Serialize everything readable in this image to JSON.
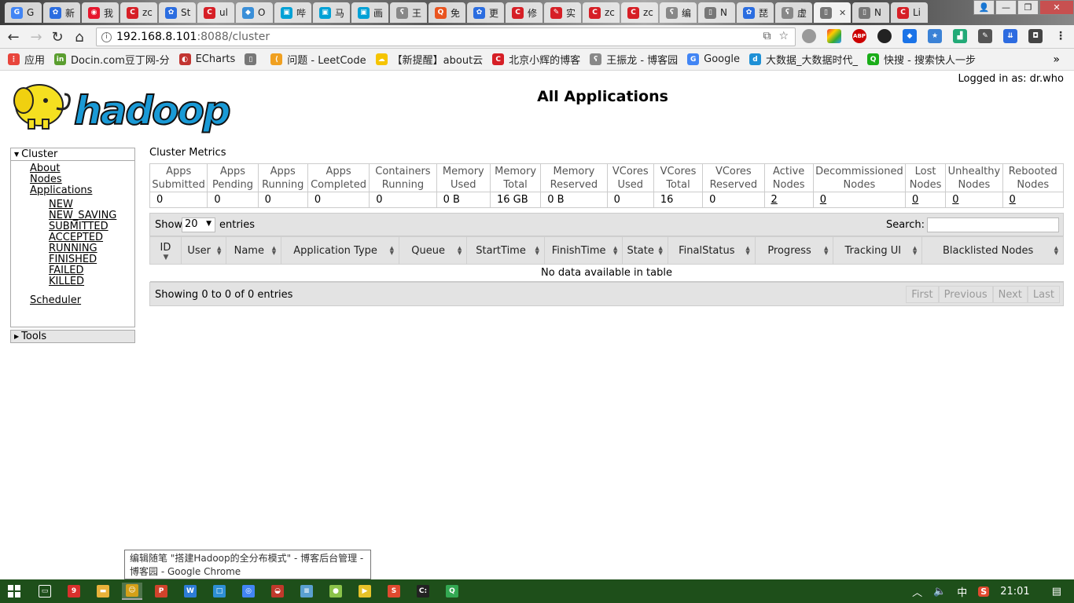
{
  "browser": {
    "tabs": [
      {
        "label": "G",
        "color": "#4285f4",
        "glyph": "G"
      },
      {
        "label": "新",
        "color": "#2b6de0",
        "glyph": "✿"
      },
      {
        "label": "我",
        "color": "#e6162d",
        "glyph": "◉"
      },
      {
        "label": "zc",
        "color": "#d61f26",
        "glyph": "C"
      },
      {
        "label": "St",
        "color": "#2b6de0",
        "glyph": "✿"
      },
      {
        "label": "ul",
        "color": "#d61f26",
        "glyph": "C"
      },
      {
        "label": "O",
        "color": "#3a8fd8",
        "glyph": "◆"
      },
      {
        "label": "哔",
        "color": "#00a1d6",
        "glyph": "▣"
      },
      {
        "label": "马",
        "color": "#00a1d6",
        "glyph": "▣"
      },
      {
        "label": "画",
        "color": "#00a1d6",
        "glyph": "▣"
      },
      {
        "label": "王",
        "color": "#888888",
        "glyph": "ʕ"
      },
      {
        "label": "免",
        "color": "#e9541f",
        "glyph": "Q"
      },
      {
        "label": "更",
        "color": "#2b6de0",
        "glyph": "✿"
      },
      {
        "label": "修",
        "color": "#d61f26",
        "glyph": "C"
      },
      {
        "label": "实",
        "color": "#d61f26",
        "glyph": "✎"
      },
      {
        "label": "zc",
        "color": "#d61f26",
        "glyph": "C"
      },
      {
        "label": "zc",
        "color": "#d61f26",
        "glyph": "C"
      },
      {
        "label": "编",
        "color": "#888888",
        "glyph": "ʕ"
      },
      {
        "label": "N",
        "color": "#777777",
        "glyph": "▯"
      },
      {
        "label": "琵",
        "color": "#2b6de0",
        "glyph": "✿"
      },
      {
        "label": "虚",
        "color": "#888888",
        "glyph": "ʕ"
      },
      {
        "label": "",
        "color": "#777777",
        "glyph": "▯",
        "active": true
      },
      {
        "label": "N",
        "color": "#777777",
        "glyph": "▯"
      },
      {
        "label": "Li",
        "color": "#d61f26",
        "glyph": "C"
      }
    ],
    "address": {
      "host": "192.168.8.101",
      "path": ":8088/cluster"
    },
    "bookmarks": [
      {
        "label": "应用",
        "color": "#e8453c",
        "glyph": "⋮"
      },
      {
        "label": "Docin.com豆丁网-分",
        "color": "#5a9e2f",
        "glyph": "in"
      },
      {
        "label": "ECharts",
        "color": "#c23531",
        "glyph": "◐"
      },
      {
        "label": "",
        "color": "#777777",
        "glyph": "▯"
      },
      {
        "label": "问题 - LeetCode",
        "color": "#f0a020",
        "glyph": "⟨"
      },
      {
        "label": "【新提醒】about云",
        "color": "#f5c400",
        "glyph": "☁"
      },
      {
        "label": "北京小辉的博客",
        "color": "#d61f26",
        "glyph": "C"
      },
      {
        "label": "王振龙 - 博客园",
        "color": "#888888",
        "glyph": "ʕ"
      },
      {
        "label": "Google",
        "color": "#4285f4",
        "glyph": "G"
      },
      {
        "label": "大数据_大数据时代_",
        "color": "#1e90d6",
        "glyph": "d"
      },
      {
        "label": "快搜 - 搜索快人一步",
        "color": "#1aad19",
        "glyph": "Q"
      }
    ]
  },
  "page": {
    "logged_in": "Logged in as: dr.who",
    "title": "All Applications",
    "logo_text": "hadoop",
    "sidebar": {
      "cluster_label": "Cluster",
      "links": [
        "About",
        "Nodes",
        "Applications"
      ],
      "states": [
        "NEW",
        "NEW_SAVING",
        "SUBMITTED",
        "ACCEPTED",
        "RUNNING",
        "FINISHED",
        "FAILED",
        "KILLED"
      ],
      "scheduler": "Scheduler",
      "tools_label": "Tools"
    },
    "metrics": {
      "title": "Cluster Metrics",
      "headers": [
        [
          "Apps",
          "Submitted"
        ],
        [
          "Apps",
          "Pending"
        ],
        [
          "Apps",
          "Running"
        ],
        [
          "Apps",
          "Completed"
        ],
        [
          "Containers",
          "Running"
        ],
        [
          "Memory",
          "Used"
        ],
        [
          "Memory",
          "Total"
        ],
        [
          "Memory",
          "Reserved"
        ],
        [
          "VCores",
          "Used"
        ],
        [
          "VCores",
          "Total"
        ],
        [
          "VCores",
          "Reserved"
        ],
        [
          "Active",
          "Nodes"
        ],
        [
          "Decommissioned",
          "Nodes"
        ],
        [
          "Lost",
          "Nodes"
        ],
        [
          "Unhealthy",
          "Nodes"
        ],
        [
          "Rebooted",
          "Nodes"
        ]
      ],
      "values": [
        "0",
        "0",
        "0",
        "0",
        "0",
        "0 B",
        "16 GB",
        "0 B",
        "0",
        "16",
        "0",
        "2",
        "0",
        "0",
        "0",
        "0"
      ],
      "linked": [
        false,
        false,
        false,
        false,
        false,
        false,
        false,
        false,
        false,
        false,
        false,
        true,
        true,
        true,
        true,
        true
      ]
    },
    "table": {
      "show_label": "Show",
      "page_size": "20",
      "entries_label": "entries",
      "search_label": "Search:",
      "columns": [
        "ID",
        "User",
        "Name",
        "Application Type",
        "Queue",
        "StartTime",
        "FinishTime",
        "State",
        "FinalStatus",
        "Progress",
        "Tracking UI",
        "Blacklisted Nodes"
      ],
      "empty_message": "No data available in table",
      "info": "Showing 0 to 0 of 0 entries",
      "pager": [
        "First",
        "Previous",
        "Next",
        "Last"
      ]
    }
  },
  "tooltip": {
    "line1": "编辑随笔 \"搭建Hadoop的全分布模式\" - 博客后台管理 -",
    "line2": "博客园 - Google Chrome"
  },
  "taskbar": {
    "time": "21:01",
    "ime": "中",
    "apps": [
      {
        "name": "task-view",
        "color": "#1e4f1a",
        "glyph": "▭"
      },
      {
        "name": "app-red",
        "color": "#d9302c",
        "glyph": "9"
      },
      {
        "name": "file-explorer",
        "color": "#e8b23a",
        "glyph": "▬"
      },
      {
        "name": "app-yellow",
        "color": "#d4a017",
        "glyph": "☺",
        "active": true
      },
      {
        "name": "wps-presentation",
        "color": "#d0432b",
        "glyph": "P"
      },
      {
        "name": "wps-writer",
        "color": "#2d7cd6",
        "glyph": "W"
      },
      {
        "name": "app-blue",
        "color": "#2e8fd4",
        "glyph": "□"
      },
      {
        "name": "chrome",
        "color": "#4285f4",
        "glyph": "◎"
      },
      {
        "name": "app-snail",
        "color": "#c0392b",
        "glyph": "◒"
      },
      {
        "name": "notepad",
        "color": "#5aa0d0",
        "glyph": "≡"
      },
      {
        "name": "app-green-yellow",
        "color": "#8bc34a",
        "glyph": "●"
      },
      {
        "name": "video-player",
        "color": "#e6c229",
        "glyph": "▶"
      },
      {
        "name": "sogou",
        "color": "#e04a2f",
        "glyph": "S"
      },
      {
        "name": "cmd",
        "color": "#222222",
        "glyph": "C:"
      },
      {
        "name": "app-quick",
        "color": "#33a852",
        "glyph": "Q"
      }
    ]
  }
}
